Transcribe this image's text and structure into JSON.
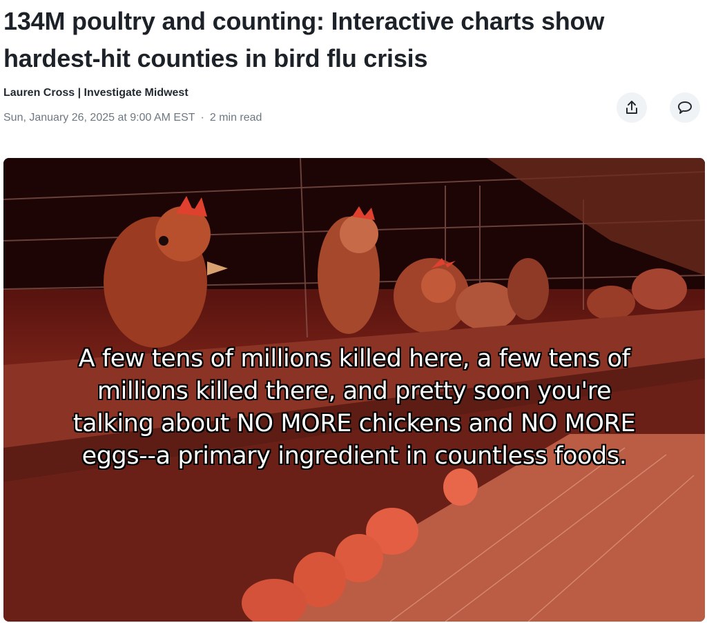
{
  "article": {
    "headline": "134M poultry and counting: Interactive charts show hardest-hit counties in bird flu crisis",
    "byline": "Lauren Cross | Investigate Midwest",
    "date": "Sun, January 26, 2025 at 9:00 AM EST",
    "separator": "·",
    "read_time": "2 min read"
  },
  "actions": {
    "share_icon": "share-icon",
    "comment_icon": "comment-icon"
  },
  "hero": {
    "caption_lines": [
      "A few tens of millions killed here, a few tens of",
      "millions killed there, and pretty soon you're",
      "talking about NO MORE chickens and NO MORE",
      "eggs--a primary ingredient in countless foods."
    ]
  },
  "colors": {
    "headline": "#1d2228",
    "meta": "#6e7780",
    "icon_bg": "#f0f3f5"
  }
}
